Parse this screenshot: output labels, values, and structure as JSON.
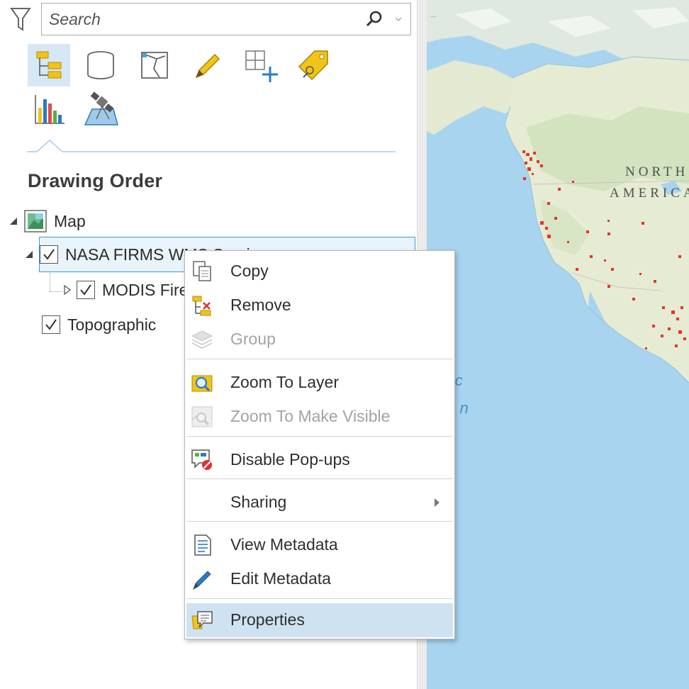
{
  "search": {
    "placeholder": "Search"
  },
  "views": [
    {
      "name": "List By Drawing Order",
      "icon": "drawing-order-icon",
      "selected": true
    },
    {
      "name": "List By Data Source",
      "icon": "data-source-icon"
    },
    {
      "name": "List By Selection",
      "icon": "selection-icon"
    },
    {
      "name": "List By Editing",
      "icon": "editing-icon"
    },
    {
      "name": "List By Snapping",
      "icon": "snapping-icon"
    },
    {
      "name": "List By Labeling",
      "icon": "labeling-icon"
    },
    {
      "name": "List Charts",
      "icon": "charts-icon"
    },
    {
      "name": "List By Perspective Imagery",
      "icon": "perspective-imagery-icon"
    }
  ],
  "pane": {
    "title": "Drawing Order"
  },
  "tree": {
    "map": {
      "label": "Map"
    },
    "layer1": {
      "label": "NASA FIRMS WMS Services",
      "checked": true
    },
    "sublayer": {
      "label": "MODIS Fires",
      "checked": true
    },
    "layer2": {
      "label": "Topographic",
      "checked": true
    }
  },
  "map_labels": {
    "continent_line1": "NORTH",
    "continent_line2": "AMERICA",
    "ocean_line1": "Pacific",
    "ocean_line2": "Ocean",
    "top_fragment": "..."
  },
  "colors": {
    "accent": "#3a9ad9",
    "menu_hover": "#cfe2f1",
    "fire_points": "#e8332b",
    "ocean": "#a5d3ee",
    "land": "#e6ecd3"
  },
  "menu": {
    "copy": "Copy",
    "remove": "Remove",
    "group": "Group",
    "zoom_to_layer": "Zoom To Layer",
    "zoom_to_visible": "Zoom To Make Visible",
    "disable_popups": "Disable Pop-ups",
    "sharing": "Sharing",
    "view_metadata": "View Metadata",
    "edit_metadata": "Edit Metadata",
    "properties": "Properties"
  }
}
